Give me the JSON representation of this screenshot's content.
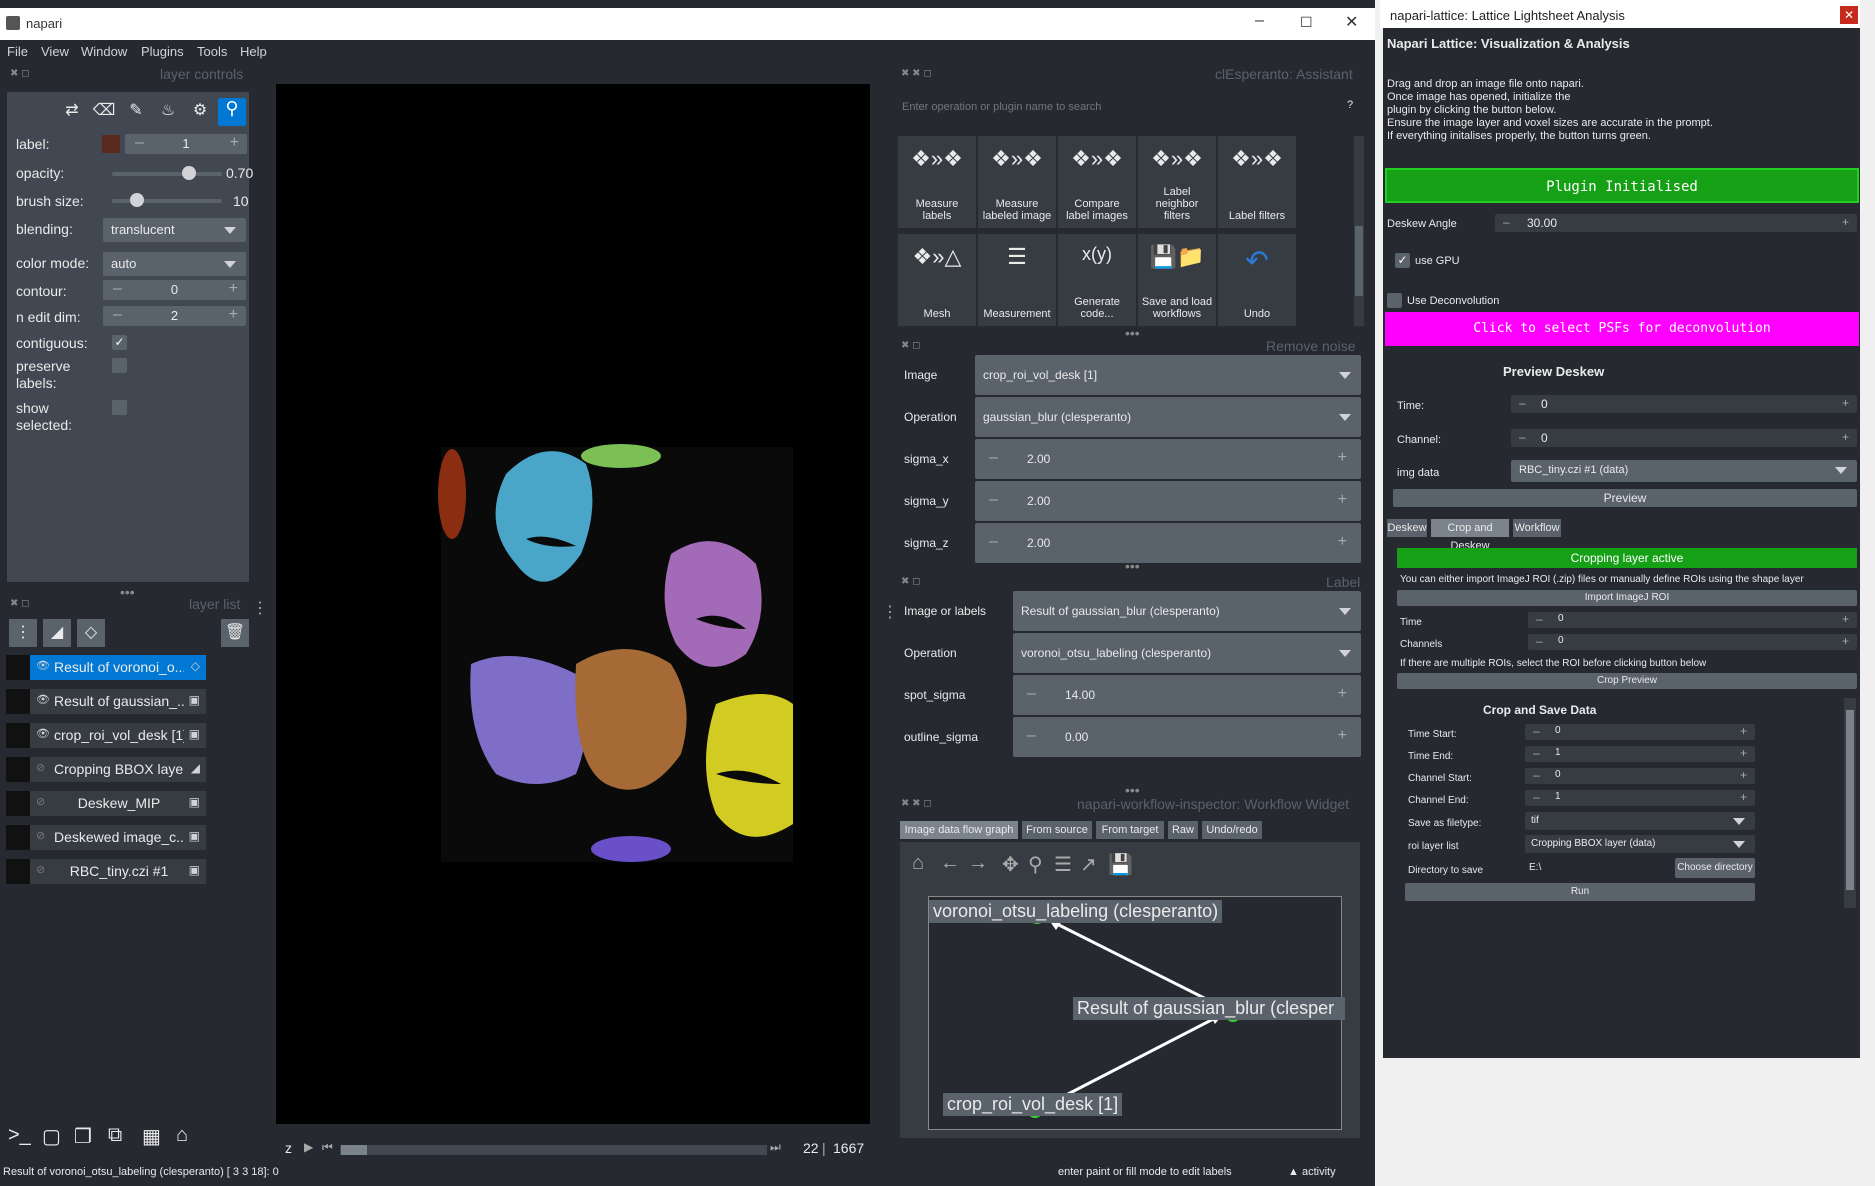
{
  "napari": {
    "title": "napari",
    "menu": [
      "File",
      "View",
      "Window",
      "Plugins",
      "Tools",
      "Help"
    ],
    "layer_controls": {
      "header": "layer controls",
      "label_label": "label:",
      "label_value": "1",
      "opacity_label": "opacity:",
      "opacity_value": "0.70",
      "opacity_level": 0.7,
      "brush_label": "brush size:",
      "brush_value": "10",
      "blending_label": "blending:",
      "blending_value": "translucent",
      "colormode_label": "color mode:",
      "colormode_value": "auto",
      "contour_label": "contour:",
      "contour_value": "0",
      "nedit_label": "n edit dim:",
      "nedit_value": "2",
      "contiguous_label": "contiguous:",
      "preserve_label": "preserve\nlabels:",
      "show_selected_label": "show\nselected:",
      "label_color": "#5a2a1f"
    },
    "layer_list": {
      "header": "layer list",
      "layers": [
        {
          "name": "Result of voronoi_o...",
          "selected": true,
          "visible": true,
          "type_icon": "tag-icon"
        },
        {
          "name": "Result of gaussian_...",
          "selected": false,
          "visible": true,
          "type_icon": "image-icon"
        },
        {
          "name": "crop_roi_vol_desk [1]",
          "selected": false,
          "visible": true,
          "type_icon": "image-icon"
        },
        {
          "name": "Cropping BBOX layer",
          "selected": false,
          "visible": false,
          "type_icon": "shapes-icon"
        },
        {
          "name": "Deskew_MIP",
          "selected": false,
          "visible": false,
          "type_icon": "image-icon"
        },
        {
          "name": "Deskewed image_c...",
          "selected": false,
          "visible": false,
          "type_icon": "image-icon"
        },
        {
          "name": "RBC_tiny.czi #1",
          "selected": false,
          "visible": false,
          "type_icon": "image-icon"
        }
      ]
    },
    "canvas": {
      "slider_axis": "z",
      "slider_value": "22",
      "slider_max": "1667"
    },
    "status_left": "Result of voronoi_otsu_labeling (clesperanto) [ 3 3 18]: 0",
    "status_right": "enter paint or fill mode to edit labels",
    "activity": "activity"
  },
  "assistant": {
    "header": "clEsperanto: Assistant",
    "search_placeholder": "Enter operation or plugin name to search",
    "help": "?",
    "tiles": [
      {
        "label": "Measure\nlabels",
        "icon": "measure-labels-icon"
      },
      {
        "label": "Measure\nlabeled image",
        "icon": "measure-labeled-image-icon"
      },
      {
        "label": "Compare\nlabel images",
        "icon": "compare-label-images-icon"
      },
      {
        "label": "Label\nneighbor\nfilters",
        "icon": "label-neighbor-filters-icon"
      },
      {
        "label": "Label filters",
        "icon": "label-filters-icon"
      },
      {
        "label": "Mesh",
        "icon": "mesh-icon"
      },
      {
        "label": "Measurement",
        "icon": "measurement-icon"
      },
      {
        "label": "Generate\ncode...",
        "icon": "generate-code-icon"
      },
      {
        "label": "Save and load\nworkflows",
        "icon": "save-load-workflows-icon"
      },
      {
        "label": "Undo",
        "icon": "undo-icon"
      }
    ]
  },
  "remove_noise": {
    "header": "Remove noise",
    "image_label": "Image",
    "image_value": "crop_roi_vol_desk [1]",
    "operation_label": "Operation",
    "operation_value": "gaussian_blur (clesperanto)",
    "sigma_x_label": "sigma_x",
    "sigma_x": "2.00",
    "sigma_y_label": "sigma_y",
    "sigma_y": "2.00",
    "sigma_z_label": "sigma_z",
    "sigma_z": "2.00"
  },
  "label": {
    "header": "Label",
    "image_label": "Image or labels",
    "image_value": "Result of gaussian_blur (clesperanto)",
    "operation_label": "Operation",
    "operation_value": "voronoi_otsu_labeling (clesperanto)",
    "spot_label": "spot_sigma",
    "spot_value": "14.00",
    "outline_label": "outline_sigma",
    "outline_value": "0.00"
  },
  "workflow": {
    "header": "napari-workflow-inspector: Workflow Widget",
    "tabs": [
      "Image data flow graph",
      "From source",
      "From target",
      "Raw",
      "Undo/redo"
    ],
    "nodes": [
      "voronoi_otsu_labeling (clesperanto)",
      "Result of gaussian_blur (clesper",
      "crop_roi_vol_desk [1]"
    ]
  },
  "lattice": {
    "title": "napari-lattice: Lattice Lightsheet Analysis",
    "heading": "Napari Lattice: Visualization & Analysis",
    "instructions": "Drag and drop an image file onto napari.\nOnce image has opened, initialize the\nplugin by clicking the button below.\nEnsure the image layer and voxel sizes are accurate in the prompt.\n If everything initalises properly, the button turns green.",
    "plugin_initialised": "Plugin Initialised",
    "deskew_angle_label": "Deskew Angle",
    "deskew_angle": "30.00",
    "use_gpu": "use GPU",
    "use_deconv": "Use Deconvolution",
    "psf_button": "Click to select PSFs for deconvolution",
    "preview_heading": "Preview Deskew",
    "time_label": "Time:",
    "time_value": "0",
    "channel_label": "Channel:",
    "channel_value": "0",
    "img_data_label": "img data",
    "img_data_value": "RBC_tiny.czi #1 (data)",
    "preview_button": "Preview",
    "tabs": [
      "Deskew",
      "Crop and Deskew",
      "Workflow"
    ],
    "crop_active": "Cropping layer active",
    "crop_info": "You can either import ImageJ ROI (.zip) files or manually define ROIs using the shape layer",
    "import_roi": "Import ImageJ ROI",
    "crop_time_label": "Time",
    "crop_time": "0",
    "crop_channels_label": "Channels",
    "crop_channels": "0",
    "multi_roi_note": "If there are multiple ROIs, select the ROI before clicking button below",
    "crop_preview": "Crop Preview",
    "crop_save_heading": "Crop and Save Data",
    "time_start_label": "Time Start:",
    "time_start": "0",
    "time_end_label": "Time End:",
    "time_end": "1",
    "channel_start_label": "Channel Start:",
    "channel_start": "0",
    "channel_end_label": "Channel End:",
    "channel_end": "1",
    "filetype_label": "Save as filetype:",
    "filetype": "tif",
    "roi_layer_label": "roi layer list",
    "roi_layer": "Cropping BBOX layer (data)",
    "dir_label": "Directory to save",
    "dir_value": "E:\\",
    "choose_dir": "Choose directory",
    "run": "Run"
  },
  "colors": {
    "napari_bg": "#262930",
    "panel": "#414851",
    "accent_blue": "#0078d4",
    "green": "#16a016",
    "magenta": "#ff00ff"
  }
}
